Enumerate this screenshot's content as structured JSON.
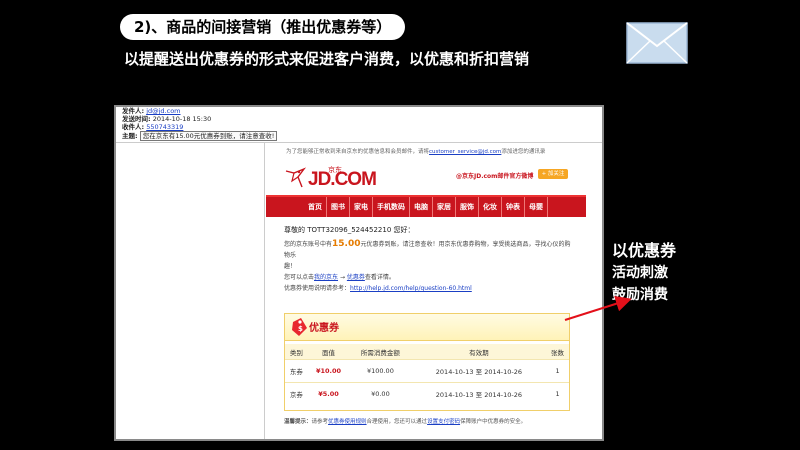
{
  "slide": {
    "title": "2)、商品的间接营销（推出优惠券等）",
    "subtitle": "以提醒送出优惠券的形式来促进客户消费，以优惠和折扣营销"
  },
  "callout": {
    "line1": "以优惠券",
    "line2": "活动刺激",
    "line3": "鼓励消费"
  },
  "mail_header": {
    "from_label": "发件人:",
    "from_value": "jd@jd.com",
    "sent_label": "发送时间:",
    "sent_value": "2014-10-18 15:30",
    "to_label": "收件人:",
    "to_value": "550743319",
    "subject_label": "主题:",
    "subject_value": "您在京东有15.00元优惠券到账，请注意查收!"
  },
  "email": {
    "notice": "为了您能够正常收到来自京东的优惠信息和会员邮件，请将",
    "notice_email": "customer_service@jd.com",
    "notice_tail": "添加进您的通讯录",
    "logo_text": "JD.COM",
    "logo_cn": "京东",
    "weibo_text": "@京东JD.com邮件官方微博",
    "follow_label": "+ 加关注",
    "nav": [
      "首页",
      "图书",
      "家电",
      "手机数码",
      "电脑",
      "家居",
      "服饰",
      "化妆",
      "钟表",
      "母婴"
    ],
    "greeting": "尊敬的 TOTT32096_524452210 您好：",
    "line1_pre": "您的京东账号中有",
    "line1_amount": "15.00",
    "line1_post": "元优惠券到账，请注意查收！用京东优惠券购物，享受挑选商品，寻找心仪的购物乐",
    "line1_end": "趣！",
    "line2_pre": "您可以点击",
    "line2_link1": "我的京东",
    "line2_arrow": " → ",
    "line2_link2": "优惠券",
    "line2_post": "查看详情。",
    "line3_pre": "优惠券使用说明请参考：",
    "line3_link": "http://help.jd.com/help/question-60.html",
    "coupon_title": "优惠券",
    "table_headers": [
      "类别",
      "面值",
      "所需消费金额",
      "有效期",
      "张数"
    ],
    "table_rows": [
      [
        "东券",
        "¥10.00",
        "¥100.00",
        "2014-10-13 至 2014-10-26",
        "1"
      ],
      [
        "京券",
        "¥5.00",
        "¥0.00",
        "2014-10-13 至 2014-10-26",
        "1"
      ]
    ],
    "tips_label": "温馨提示：",
    "tips_pre": "请参考",
    "tips_link1": "优惠券使用规则",
    "tips_mid": "合理使用，您还可以通过",
    "tips_link2": "设置支付密码",
    "tips_post": "保障账户中优惠券的安全。"
  },
  "colors": {
    "jd_red": "#c9151e",
    "amount_orange": "#e57b00",
    "arrow_red": "#e3101a"
  }
}
